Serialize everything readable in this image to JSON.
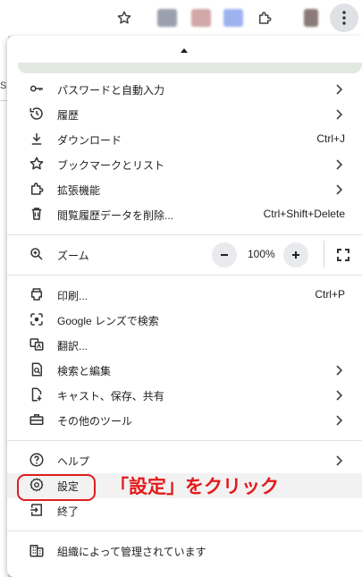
{
  "browser": {
    "extension_colors": [
      "#9aa0ad",
      "#d2a7a7",
      "#9fb2f0",
      "#8a7a78"
    ]
  },
  "page_fragment": {
    "text": "ST"
  },
  "menu": {
    "groups": [
      [
        {
          "label": "パスワードと自動入力",
          "icon": "key-icon",
          "submenu": true
        },
        {
          "label": "履歴",
          "icon": "history-icon",
          "submenu": true
        },
        {
          "label": "ダウンロード",
          "icon": "download-icon",
          "shortcut": "Ctrl+J"
        },
        {
          "label": "ブックマークとリスト",
          "icon": "star-icon",
          "submenu": true
        },
        {
          "label": "拡張機能",
          "icon": "puzzle-icon",
          "submenu": true
        },
        {
          "label": "閲覧履歴データを削除...",
          "icon": "trash-icon",
          "shortcut": "Ctrl+Shift+Delete"
        }
      ],
      [
        {
          "label": "印刷...",
          "icon": "printer-icon",
          "shortcut": "Ctrl+P"
        },
        {
          "label": "Google レンズで検索",
          "icon": "lens-icon"
        },
        {
          "label": "翻訳...",
          "icon": "translate-icon"
        },
        {
          "label": "検索と編集",
          "icon": "find-edit-icon",
          "submenu": true
        },
        {
          "label": "キャスト、保存、共有",
          "icon": "cast-save-share-icon",
          "submenu": true
        },
        {
          "label": "その他のツール",
          "icon": "toolbox-icon",
          "submenu": true
        }
      ],
      [
        {
          "label": "ヘルプ",
          "icon": "help-icon",
          "submenu": true
        },
        {
          "label": "設定",
          "icon": "settings-icon"
        },
        {
          "label": "終了",
          "icon": "exit-icon"
        }
      ],
      [
        {
          "label": "組織によって管理されています",
          "icon": "building-icon"
        }
      ]
    ],
    "zoom": {
      "label": "ズーム",
      "value": "100%",
      "minus": "−",
      "plus": "+"
    }
  },
  "annotation": {
    "text": "「設定」をクリック",
    "color": "#e41a1a"
  }
}
